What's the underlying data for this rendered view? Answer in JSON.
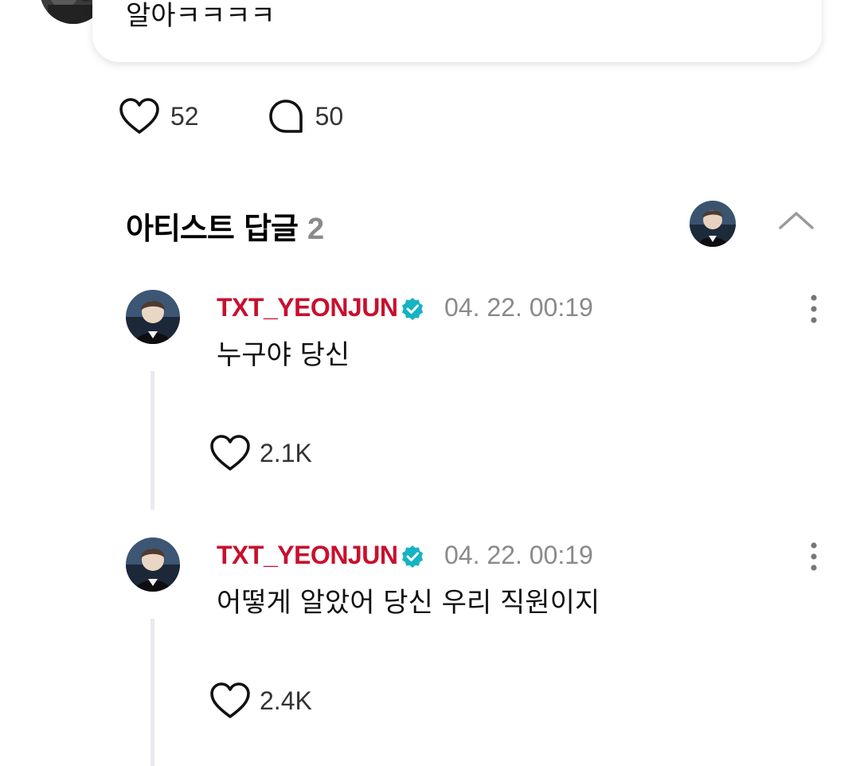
{
  "post": {
    "text": "알아ㅋㅋㅋㅋ",
    "likes": "52",
    "comments": "50"
  },
  "artist_replies": {
    "title": "아티스트 답글",
    "count": "2"
  },
  "replies": [
    {
      "author": "TXT_YEONJUN",
      "timestamp": "04. 22. 00:19",
      "text": "누구야 당신",
      "likes": "2.1K"
    },
    {
      "author": "TXT_YEONJUN",
      "timestamp": "04. 22. 00:19",
      "text": "어떻게 알았어 당신 우리 직원이지",
      "likes": "2.4K"
    }
  ],
  "colors": {
    "author_name": "#c8102e",
    "verified_badge": "#15b3c4",
    "muted_text": "#8a8a8a",
    "thread_line": "#e9e9ee"
  },
  "icons": [
    "heart-icon",
    "comment-bubble-icon",
    "chevron-up-icon",
    "verified-badge-icon",
    "more-vertical-icon"
  ]
}
